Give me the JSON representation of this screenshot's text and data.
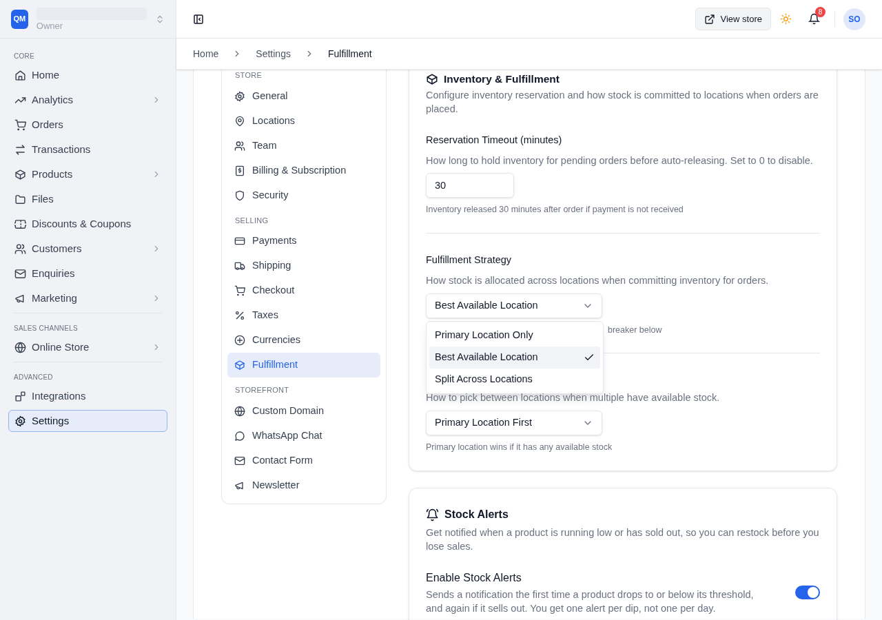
{
  "sidebar": {
    "logo": "QM",
    "role": "Owner",
    "sections": [
      {
        "heading": "CORE",
        "items": [
          {
            "label": "Home",
            "has_submenu": false,
            "selected": false
          },
          {
            "label": "Analytics",
            "has_submenu": true,
            "selected": false
          },
          {
            "label": "Orders",
            "has_submenu": false,
            "selected": false
          },
          {
            "label": "Transactions",
            "has_submenu": false,
            "selected": false
          },
          {
            "label": "Products",
            "has_submenu": true,
            "selected": false
          },
          {
            "label": "Files",
            "has_submenu": false,
            "selected": false
          },
          {
            "label": "Discounts & Coupons",
            "has_submenu": false,
            "selected": false
          },
          {
            "label": "Customers",
            "has_submenu": true,
            "selected": false
          },
          {
            "label": "Enquiries",
            "has_submenu": false,
            "selected": false
          },
          {
            "label": "Marketing",
            "has_submenu": true,
            "selected": false
          }
        ]
      },
      {
        "heading": "SALES CHANNELS",
        "items": [
          {
            "label": "Online Store",
            "has_submenu": true,
            "selected": false
          }
        ]
      },
      {
        "heading": "ADVANCED",
        "items": [
          {
            "label": "Integrations",
            "has_submenu": false,
            "selected": false
          },
          {
            "label": "Settings",
            "has_submenu": false,
            "selected": true
          }
        ]
      }
    ]
  },
  "header": {
    "view_store": "View store",
    "notification_count": "8",
    "avatar": "SO"
  },
  "breadcrumb": [
    {
      "label": "Home",
      "current": false
    },
    {
      "label": "Settings",
      "current": false
    },
    {
      "label": "Fulfillment",
      "current": true
    }
  ],
  "settings_nav": {
    "sections": [
      {
        "heading": "STORE",
        "items": [
          {
            "label": "General",
            "selected": false
          },
          {
            "label": "Locations",
            "selected": false
          },
          {
            "label": "Team",
            "selected": false
          },
          {
            "label": "Billing & Subscription",
            "selected": false
          },
          {
            "label": "Security",
            "selected": false
          }
        ]
      },
      {
        "heading": "SELLING",
        "items": [
          {
            "label": "Payments",
            "selected": false
          },
          {
            "label": "Shipping",
            "selected": false
          },
          {
            "label": "Checkout",
            "selected": false
          },
          {
            "label": "Taxes",
            "selected": false
          },
          {
            "label": "Currencies",
            "selected": false
          },
          {
            "label": "Fulfillment",
            "selected": true
          }
        ]
      },
      {
        "heading": "STOREFRONT",
        "items": [
          {
            "label": "Custom Domain",
            "selected": false
          },
          {
            "label": "WhatsApp Chat",
            "selected": false
          },
          {
            "label": "Contact Form",
            "selected": false
          },
          {
            "label": "Newsletter",
            "selected": false
          }
        ]
      }
    ]
  },
  "inventory_card": {
    "title": "Inventory & Fulfillment",
    "description": "Configure inventory reservation and how stock is committed to locations when orders are placed.",
    "reservation": {
      "label": "Reservation Timeout (minutes)",
      "description": "How long to hold inventory for pending orders before auto-releasing. Set to 0 to disable.",
      "value": "30",
      "hint": "Inventory released 30 minutes after order if payment is not received"
    },
    "strategy": {
      "label": "Fulfillment Strategy",
      "description": "How stock is allocated across locations when committing inventory for orders.",
      "value": "Best Available Location",
      "expanded": true,
      "options": [
        {
          "label": "Primary Location Only",
          "selected": false
        },
        {
          "label": "Best Available Location",
          "selected": true
        },
        {
          "label": "Split Across Locations",
          "selected": false
        }
      ],
      "hint": "breaker below"
    },
    "tie_breaker": {
      "description": "How to pick between locations when multiple have available stock.",
      "value": "Primary Location First",
      "hint": "Primary location wins if it has any available stock"
    }
  },
  "stock_alerts_card": {
    "title": "Stock Alerts",
    "description": "Get notified when a product is running low or has sold out, so you can restock before you lose sales.",
    "setting": {
      "label": "Enable Stock Alerts",
      "description": "Sends a notification the first time a product drops to or below its threshold, and again if it sells out. You get one alert per dip, not one per day.",
      "on": true
    }
  }
}
